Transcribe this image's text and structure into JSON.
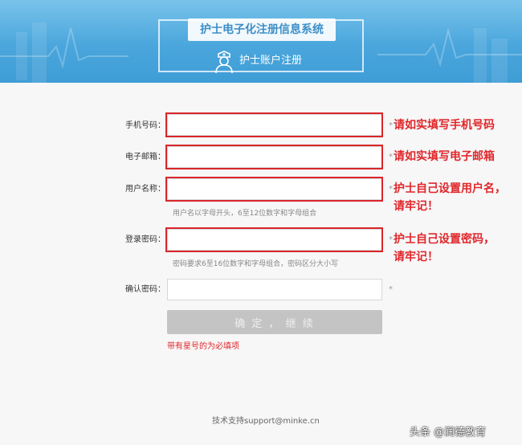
{
  "header": {
    "system_title": "护士电子化注册信息系统",
    "subtitle": "护士账户注册"
  },
  "form": {
    "fields": [
      {
        "label": "手机号码：",
        "value": "",
        "star": "*"
      },
      {
        "label": "电子邮箱：",
        "value": "",
        "star": "*"
      },
      {
        "label": "用户名称：",
        "value": "",
        "star": "*",
        "hint": "用户名以字母开头，6至12位数字和字母组合"
      },
      {
        "label": "登录密码：",
        "value": "",
        "star": "*",
        "hint": "密码要求6至16位数字和字母组合，密码区分大小写"
      },
      {
        "label": "确认密码：",
        "value": "",
        "star": "*"
      }
    ],
    "submit_label": "确 定 ， 继 续",
    "required_note": "带有星号的为必填项"
  },
  "annotations": {
    "phone": "请如实填写手机号码",
    "email": "请如实填写电子邮箱",
    "username_line1": "护士自己设置用户名，",
    "username_line2": "请牢记！",
    "password_line1": "护士自己设置密码，",
    "password_line2": "请牢记！",
    "color": "#e0272c"
  },
  "footer": {
    "support": "技术支持support@minke.cn"
  },
  "watermark": {
    "text": "头条 @润德教育"
  },
  "colors": {
    "header": "#4aa6dc",
    "highlight": "#d9262b",
    "button": "#c4c4c4"
  }
}
